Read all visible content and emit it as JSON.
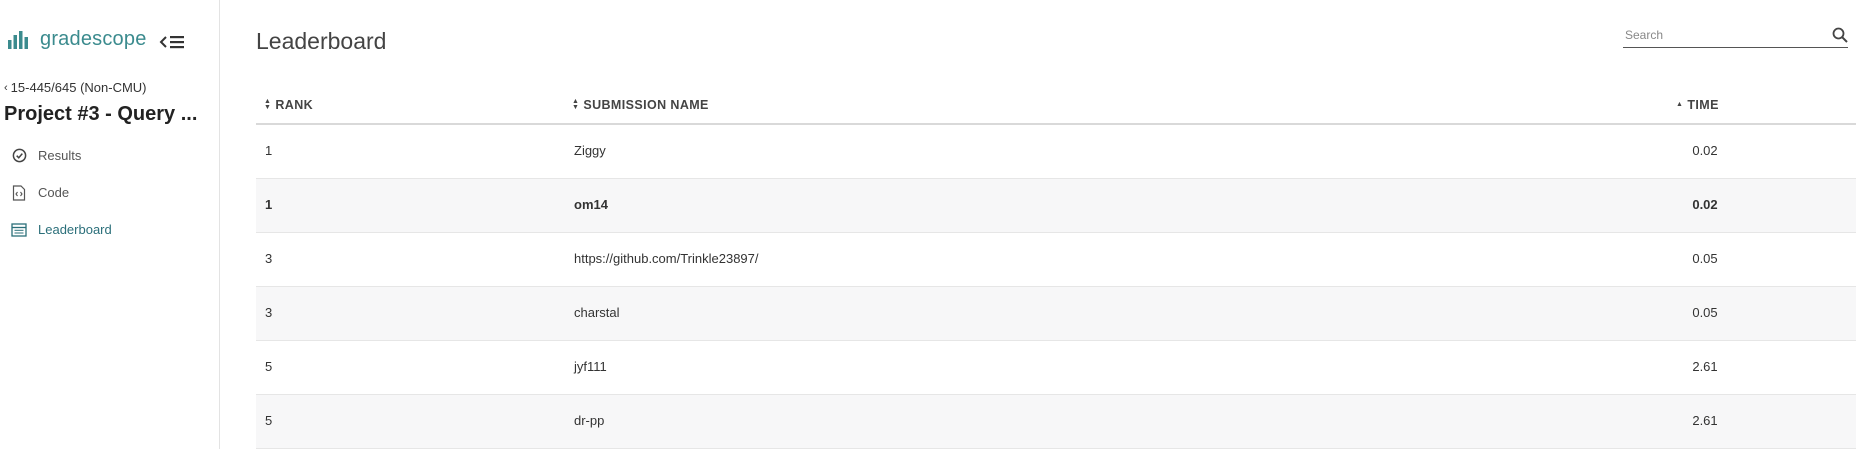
{
  "brand": {
    "name": "gradescope"
  },
  "sidebar": {
    "course_link": "15-445/645 (Non-CMU)",
    "assignment_title": "Project #3 - Query ...",
    "nav": [
      {
        "label": "Results",
        "icon": "check-circle-icon",
        "active": false
      },
      {
        "label": "Code",
        "icon": "code-file-icon",
        "active": false
      },
      {
        "label": "Leaderboard",
        "icon": "leaderboard-icon",
        "active": true
      }
    ]
  },
  "main": {
    "title": "Leaderboard",
    "search": {
      "placeholder": "Search",
      "value": ""
    },
    "table": {
      "columns": {
        "rank": "RANK",
        "name": "SUBMISSION NAME",
        "time": "TIME"
      },
      "rows": [
        {
          "rank": "1",
          "name": "Ziggy",
          "time": "0.02",
          "highlighted": false
        },
        {
          "rank": "1",
          "name": "om14",
          "time": "0.02",
          "highlighted": true
        },
        {
          "rank": "3",
          "name": "https://github.com/Trinkle23897/",
          "time": "0.05",
          "highlighted": false
        },
        {
          "rank": "3",
          "name": "charstal",
          "time": "0.05",
          "highlighted": false
        },
        {
          "rank": "5",
          "name": "jyf111",
          "time": "2.61",
          "highlighted": false
        },
        {
          "rank": "5",
          "name": "dr-pp",
          "time": "2.61",
          "highlighted": false
        }
      ]
    }
  },
  "colors": {
    "brand": "#3b8b8e",
    "active_nav": "#2b6f7a",
    "row_alt": "#f7f7f8"
  }
}
